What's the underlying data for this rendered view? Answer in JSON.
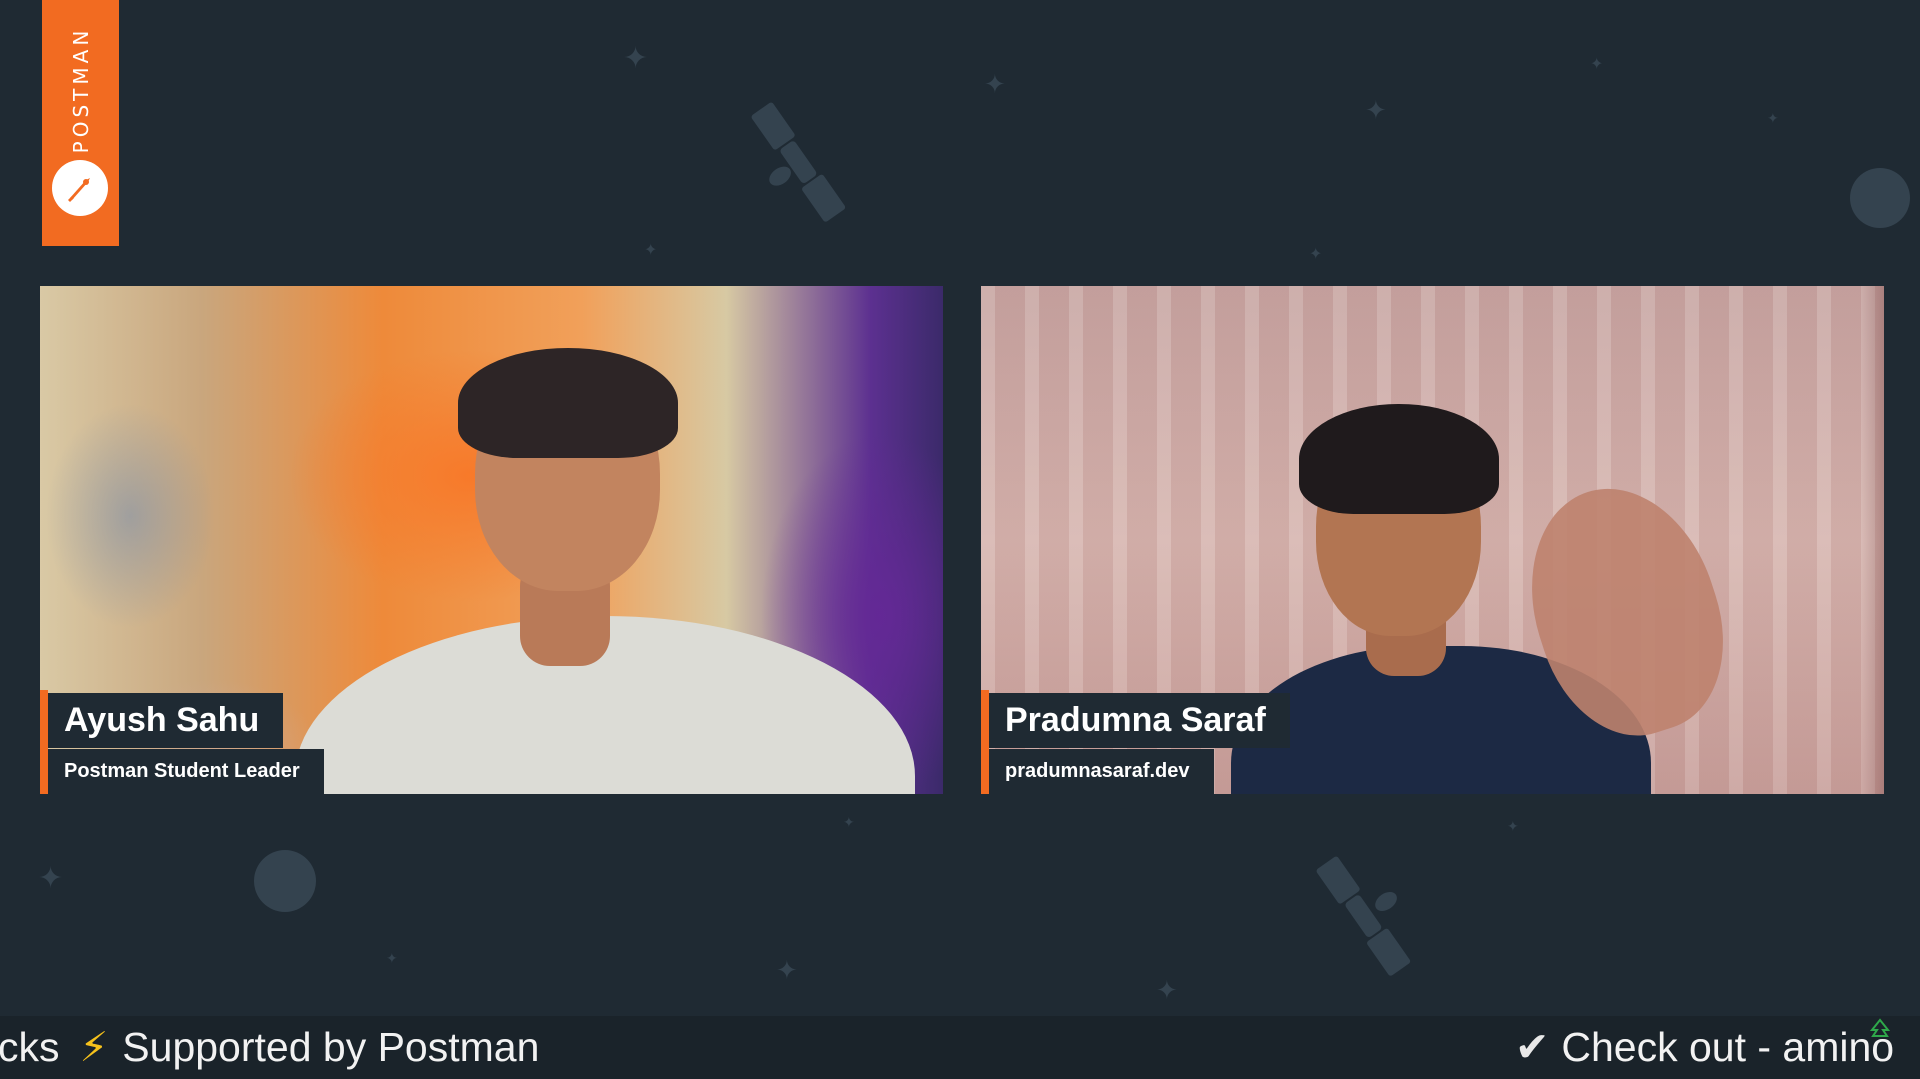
{
  "brand": {
    "name": "POSTMAN",
    "color": "#f26b21",
    "logo_icon": "postman-rocket-icon"
  },
  "participants": [
    {
      "name": "Ayush Sahu",
      "subtitle": "Postman Student Leader"
    },
    {
      "name": "Pradumna Saraf",
      "subtitle": "pradumnasaraf.dev"
    }
  ],
  "ticker": {
    "left_fragment": "cks",
    "separator_icon": "lightning-bolt-icon",
    "supported_text": "Supported by Postman",
    "check_icon": "checkmark-icon",
    "checkout_text": "Check out - amino"
  },
  "colors": {
    "background": "#1f2a33",
    "accent": "#f26b21",
    "ticker_bg": "#1a232a",
    "bolt": "#f6c21c"
  }
}
